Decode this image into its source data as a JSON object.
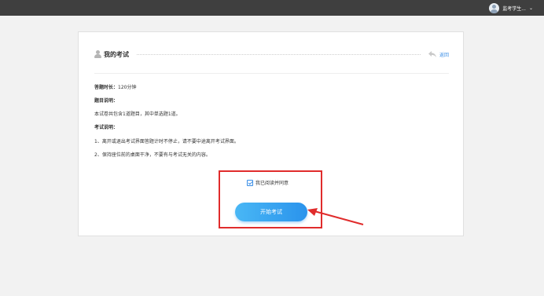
{
  "topbar": {
    "user_name": "监考学生...",
    "caret": "⌄"
  },
  "card": {
    "title": "我的考试",
    "back_label": "返回"
  },
  "exam": {
    "duration_label": "答题时长：",
    "duration_value": "120分钟",
    "question_heading": "题目说明：",
    "question_text": "本试卷共包含1道题目，其中单选题1道。",
    "exam_heading": "考试说明：",
    "rule_1": "1、离开或退出考试界面答题计时不停止，请不要中途离开考试界面。",
    "rule_2": "2、保持座位前的桌面干净，不要有与考试无关的内容。"
  },
  "agreement": {
    "label": "我已阅读并同意",
    "checked": true
  },
  "start_button_label": "开始考试",
  "colors": {
    "topbar": "#3f3f3f",
    "accent": "#2a93ec",
    "highlight": "#e02c2c",
    "background": "#f2f2f2"
  }
}
